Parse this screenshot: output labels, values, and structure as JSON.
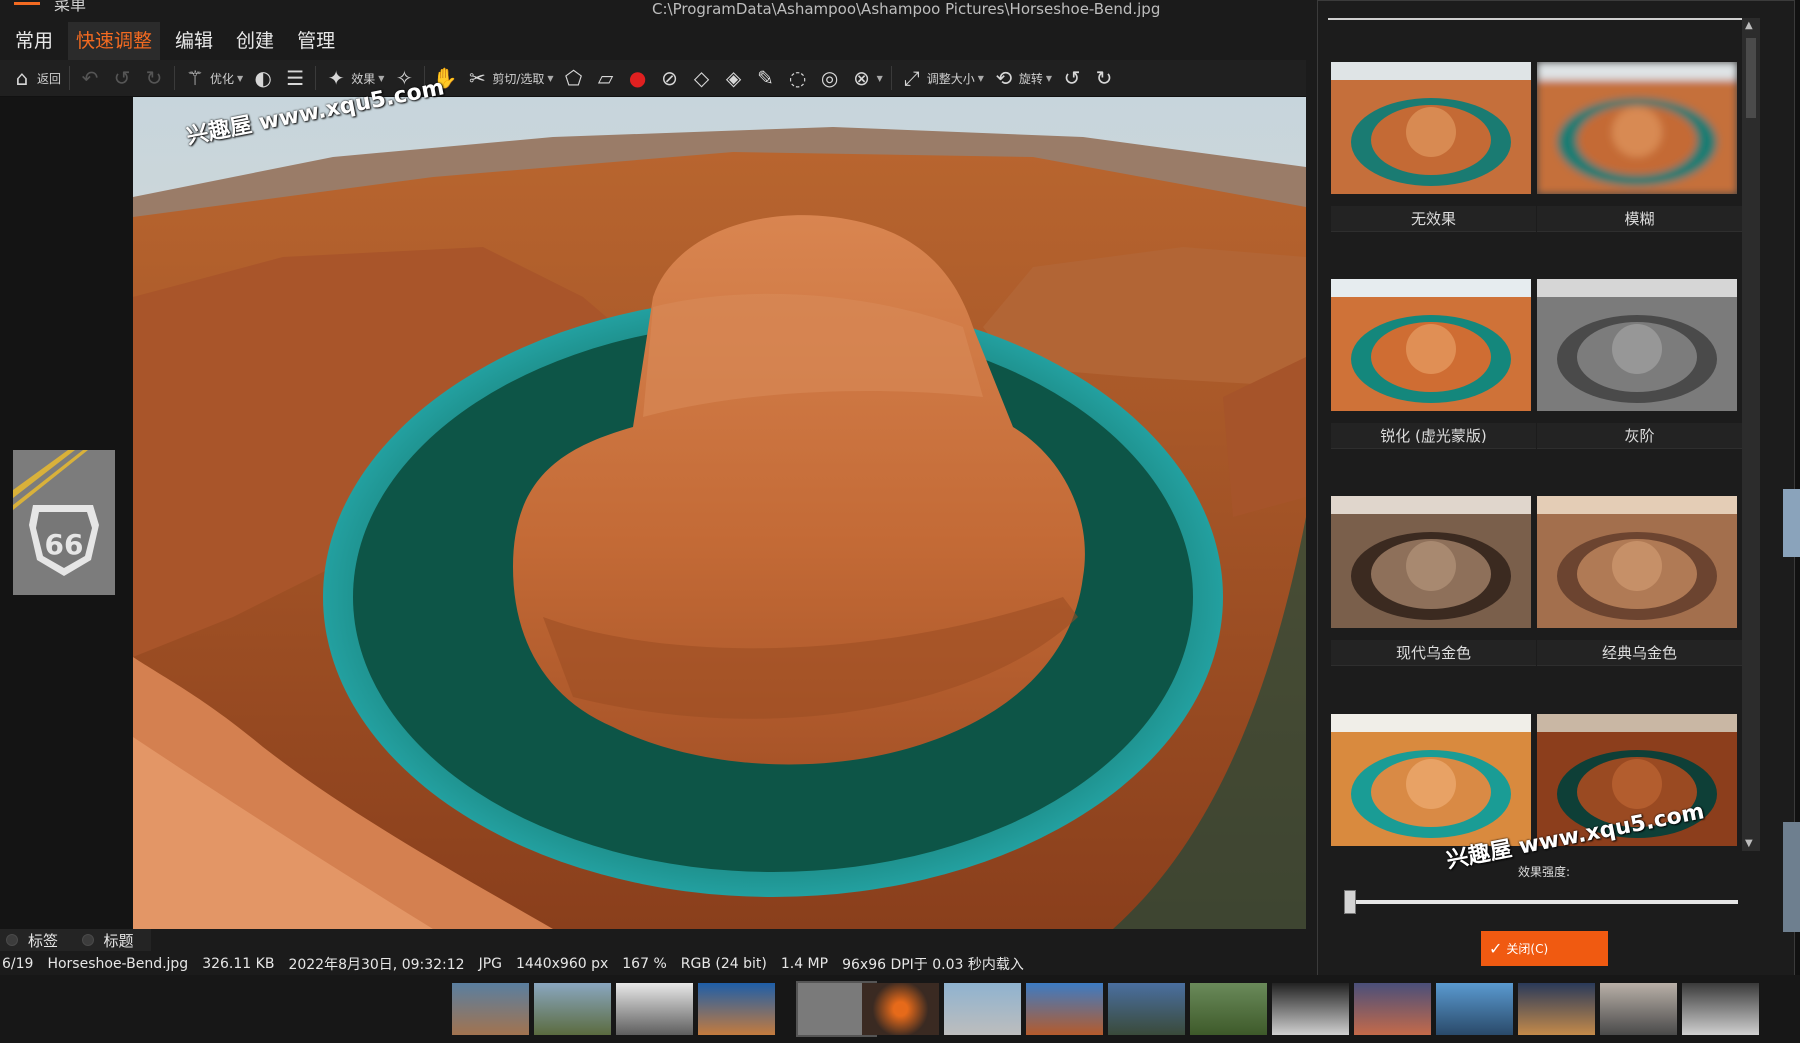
{
  "window": {
    "title_path": "C:\\ProgramData\\Ashampoo\\Ashampoo Pictures\\Horseshoe-Bend.jpg",
    "menu_cut_text": "菜单"
  },
  "menu": {
    "items": [
      "常用",
      "快速调整",
      "编辑",
      "创建",
      "管理"
    ],
    "active": "快速调整"
  },
  "toolbar": {
    "back_label": "返回",
    "optimize_label": "优化",
    "effects_label": "效果",
    "crop_label": "剪切/选取",
    "resize_label": "调整大小",
    "rotate_label": "旋转"
  },
  "watermark": {
    "text": "兴趣屋 www.xqu5.com"
  },
  "effects_panel": {
    "items": [
      {
        "name": "无效果",
        "style": "normal"
      },
      {
        "name": "模糊",
        "style": "blur"
      },
      {
        "name": "锐化 (虚光蒙版)",
        "style": "sharp"
      },
      {
        "name": "灰阶",
        "style": "gray"
      },
      {
        "name": "现代乌金色",
        "style": "modern-sepia"
      },
      {
        "name": "经典乌金色",
        "style": "classic-sepia"
      },
      {
        "name": "",
        "style": "vivid"
      },
      {
        "name": "",
        "style": "dark"
      }
    ],
    "strength_label": "效果强度:",
    "strength_value": 0,
    "close_label": "关闭(C)"
  },
  "bottom_tabs": [
    "标签",
    "标题"
  ],
  "status": {
    "index": "6/19",
    "filename": "Horseshoe-Bend.jpg",
    "filesize": "326.11 KB",
    "date": "2022年8月30日, 09:32:12",
    "format": "JPG",
    "dimensions": "1440x960 px",
    "zoom": "167 %",
    "color": "RGB (24 bit)",
    "mp": "1.4 MP",
    "dpi_load": "96x96 DPI于 0.03 秒内载入"
  },
  "left_thumb_sign": "66",
  "colors": {
    "accent": "#f26a21",
    "close_button": "#f05a11"
  }
}
